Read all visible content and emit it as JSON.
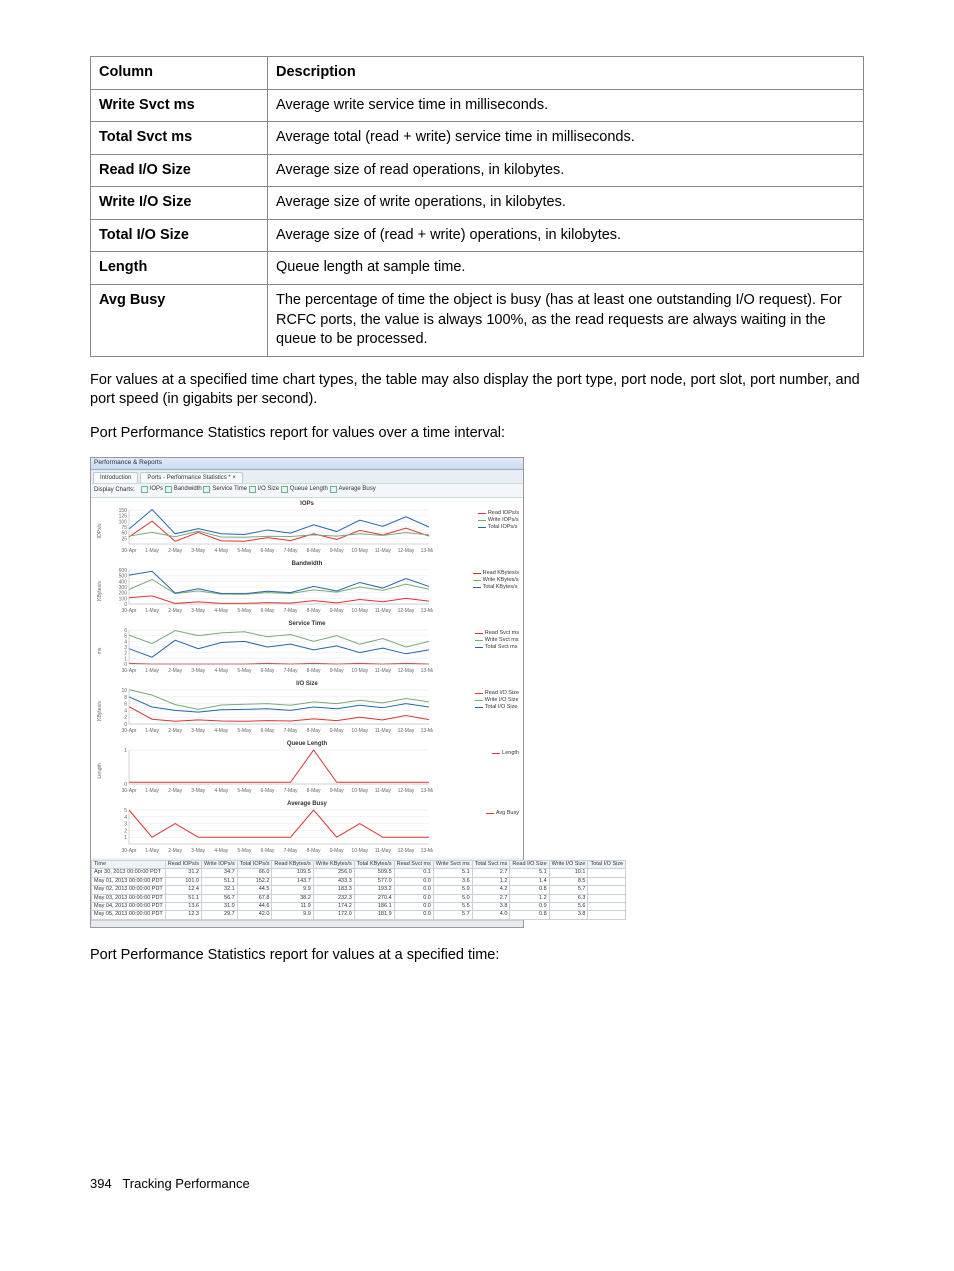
{
  "table": {
    "headers": [
      "Column",
      "Description"
    ],
    "rows": [
      {
        "col": "Write Svct ms",
        "desc": "Average write service time in milliseconds."
      },
      {
        "col": "Total Svct ms",
        "desc": "Average total (read + write) service time in milliseconds."
      },
      {
        "col": "Read I/O Size",
        "desc": "Average size of read operations, in kilobytes."
      },
      {
        "col": "Write I/O Size",
        "desc": "Average size of write operations, in kilobytes."
      },
      {
        "col": "Total I/O Size",
        "desc": "Average size of (read + write) operations, in kilobytes."
      },
      {
        "col": "Length",
        "desc": "Queue length at sample time."
      },
      {
        "col": "Avg Busy",
        "desc": "The percentage of time the object is busy (has at least one outstanding I/O request). For RCFC ports, the value is always 100%, as the read requests are always waiting in the queue to be processed."
      }
    ]
  },
  "para1": "For values at a specified time chart types, the table may also display the port type, port node, port slot, port number, and port speed (in gigabits per second).",
  "para2": "Port Performance Statistics report for values over a time interval:",
  "para3": "Port Performance Statistics report for values at a specified time:",
  "footer": {
    "page": "394",
    "title": "Tracking Performance"
  },
  "screenshot": {
    "windowTitle": "Performance & Reports",
    "tabs": [
      "Introduction",
      "Ports - Performance Statistics * ×"
    ],
    "toolbar": {
      "label": "Display Charts:",
      "checks": [
        "IOPs",
        "Bandwidth",
        "Service Time",
        "I/O Size",
        "Queue Length",
        "Average Busy"
      ]
    },
    "xcats": [
      "30-Apr",
      "1-May",
      "2-May",
      "3-May",
      "4-May",
      "5-May",
      "6-May",
      "7-May",
      "8-May",
      "9-May",
      "10-May",
      "11-May",
      "12-May",
      "13-May"
    ],
    "colors": {
      "read": "#d33",
      "write": "#7a7",
      "total": "#26a",
      "single": "#d33"
    },
    "dataHeaders": [
      "Time",
      "Read IOPs/s",
      "Write IOPs/s",
      "Total IOPs/s",
      "Read KBytes/s",
      "Write KBytes/s",
      "Total KBytes/s",
      "Read Svct ms",
      "Write Svct ms",
      "Total Svct ms",
      "Read I/O Size",
      "Write I/O Size",
      "Total I/O Size"
    ],
    "dataRows": [
      [
        "Apr 30, 2013 00:00:00 PDT",
        "31.2",
        "34.7",
        "66.0",
        "109.5",
        "256.0",
        "509.5",
        "0.1",
        "5.1",
        "2.7",
        "5.1",
        "10.1",
        ""
      ],
      [
        "May 01, 2013 00:00:00 PDT",
        "101.0",
        "51.1",
        "152.2",
        "143.7",
        "433.3",
        "577.0",
        "0.0",
        "3.6",
        "1.2",
        "1.4",
        "8.5",
        ""
      ],
      [
        "May 02, 2013 00:00:00 PDT",
        "12.4",
        "32.1",
        "44.5",
        "9.9",
        "183.3",
        "193.2",
        "0.0",
        "5.9",
        "4.2",
        "0.8",
        "5.7",
        ""
      ],
      [
        "May 03, 2013 00:00:00 PDT",
        "51.1",
        "56.7",
        "67.8",
        "38.2",
        "232.3",
        "270.4",
        "0.0",
        "5.0",
        "2.7",
        "1.2",
        "6.3",
        ""
      ],
      [
        "May 04, 2013 00:00:00 PDT",
        "13.6",
        "31.0",
        "44.6",
        "11.9",
        "174.2",
        "186.1",
        "0.0",
        "5.5",
        "3.8",
        "0.9",
        "5.6",
        ""
      ],
      [
        "May 05, 2013 00:00:00 PDT",
        "12.3",
        "29.7",
        "42.0",
        "9.9",
        "172.0",
        "181.9",
        "0.0",
        "5.7",
        "4.0",
        "0.8",
        "3.8",
        ""
      ]
    ]
  },
  "chart_data": [
    {
      "type": "line",
      "title": "IOPs",
      "ylabel": "IOPs/s",
      "x": [
        "30-Apr",
        "1-May",
        "2-May",
        "3-May",
        "4-May",
        "5-May",
        "6-May",
        "7-May",
        "8-May",
        "9-May",
        "10-May",
        "11-May",
        "12-May",
        "13-May"
      ],
      "ylim": [
        0,
        150
      ],
      "yticks": [
        25,
        50,
        75,
        100,
        125,
        150
      ],
      "series": [
        {
          "name": "Read IOPs/s",
          "color": "#d33",
          "values": [
            31,
            101,
            12,
            51,
            14,
            12,
            28,
            15,
            45,
            20,
            60,
            40,
            70,
            35
          ]
        },
        {
          "name": "Write IOPs/s",
          "color": "#7a7",
          "values": [
            35,
            51,
            32,
            57,
            31,
            30,
            34,
            33,
            40,
            35,
            45,
            38,
            50,
            40
          ]
        },
        {
          "name": "Total IOPs/s",
          "color": "#26a",
          "values": [
            66,
            152,
            45,
            68,
            45,
            42,
            62,
            48,
            85,
            55,
            105,
            78,
            120,
            75
          ]
        }
      ]
    },
    {
      "type": "line",
      "title": "Bandwidth",
      "ylabel": "KBytes/s",
      "x": [
        "30-Apr",
        "1-May",
        "2-May",
        "3-May",
        "4-May",
        "5-May",
        "6-May",
        "7-May",
        "8-May",
        "9-May",
        "10-May",
        "11-May",
        "12-May",
        "13-May"
      ],
      "ylim": [
        0,
        600
      ],
      "yticks": [
        0,
        100,
        200,
        300,
        400,
        500,
        600
      ],
      "series": [
        {
          "name": "Read KBytes/s",
          "color": "#d33",
          "values": [
            110,
            144,
            10,
            38,
            12,
            10,
            25,
            15,
            60,
            20,
            80,
            40,
            100,
            50
          ]
        },
        {
          "name": "Write KBytes/s",
          "color": "#7a7",
          "values": [
            256,
            433,
            183,
            232,
            174,
            172,
            200,
            185,
            250,
            210,
            300,
            240,
            350,
            260
          ]
        },
        {
          "name": "Total KBytes/s",
          "color": "#26a",
          "values": [
            510,
            577,
            193,
            270,
            186,
            182,
            225,
            200,
            310,
            230,
            380,
            280,
            450,
            310
          ]
        }
      ]
    },
    {
      "type": "line",
      "title": "Service Time",
      "ylabel": "ms",
      "x": [
        "30-Apr",
        "1-May",
        "2-May",
        "3-May",
        "4-May",
        "5-May",
        "6-May",
        "7-May",
        "8-May",
        "9-May",
        "10-May",
        "11-May",
        "12-May",
        "13-May"
      ],
      "ylim": [
        0,
        6
      ],
      "yticks": [
        0,
        1,
        2,
        3,
        4,
        5,
        6
      ],
      "series": [
        {
          "name": "Read Svct ms",
          "color": "#d33",
          "values": [
            0.1,
            0.0,
            0.0,
            0.0,
            0.0,
            0.0,
            0.1,
            0.0,
            0.1,
            0.0,
            0.1,
            0.0,
            0.1,
            0.0
          ]
        },
        {
          "name": "Write Svct ms",
          "color": "#7a7",
          "values": [
            5.1,
            3.6,
            5.9,
            5.0,
            5.5,
            5.7,
            4.8,
            5.2,
            4.0,
            5.0,
            3.5,
            4.5,
            3.0,
            4.0
          ]
        },
        {
          "name": "Total Svct ms",
          "color": "#26a",
          "values": [
            2.7,
            1.2,
            4.2,
            2.7,
            3.8,
            4.0,
            3.0,
            3.5,
            2.5,
            3.2,
            2.0,
            2.8,
            1.8,
            2.5
          ]
        }
      ]
    },
    {
      "type": "line",
      "title": "I/O Size",
      "ylabel": "KBytes/s",
      "x": [
        "30-Apr",
        "1-May",
        "2-May",
        "3-May",
        "4-May",
        "5-May",
        "6-May",
        "7-May",
        "8-May",
        "9-May",
        "10-May",
        "11-May",
        "12-May",
        "13-May"
      ],
      "ylim": [
        0,
        10
      ],
      "yticks": [
        0,
        2,
        4,
        6,
        8,
        10
      ],
      "series": [
        {
          "name": "Read I/O Size",
          "color": "#d33",
          "values": [
            5.1,
            1.4,
            0.8,
            1.2,
            0.9,
            0.8,
            1.0,
            0.9,
            1.5,
            1.0,
            2.0,
            1.2,
            2.5,
            1.3
          ]
        },
        {
          "name": "Write I/O Size",
          "color": "#7a7",
          "values": [
            10.1,
            8.5,
            5.7,
            4.3,
            5.6,
            5.8,
            6.0,
            5.5,
            6.5,
            6.0,
            7.0,
            6.2,
            7.5,
            6.5
          ]
        },
        {
          "name": "Total I/O Size",
          "color": "#26a",
          "values": [
            8.0,
            5.0,
            4.0,
            3.5,
            4.2,
            4.3,
            4.5,
            4.0,
            5.0,
            4.5,
            5.5,
            4.8,
            6.0,
            5.0
          ]
        }
      ]
    },
    {
      "type": "line",
      "title": "Queue Length",
      "ylabel": "Length",
      "x": [
        "30-Apr",
        "1-May",
        "2-May",
        "3-May",
        "4-May",
        "5-May",
        "6-May",
        "7-May",
        "8-May",
        "9-May",
        "10-May",
        "11-May",
        "12-May",
        "13-May"
      ],
      "ylim": [
        0,
        1
      ],
      "yticks": [
        0,
        1
      ],
      "series": [
        {
          "name": "Length",
          "color": "#d33",
          "values": [
            0.05,
            0.05,
            0.05,
            0.05,
            0.05,
            0.05,
            0.05,
            0.05,
            1.0,
            0.05,
            0.05,
            0.05,
            0.05,
            0.05
          ]
        }
      ]
    },
    {
      "type": "line",
      "title": "Average Busy",
      "ylabel": "",
      "x": [
        "30-Apr",
        "1-May",
        "2-May",
        "3-May",
        "4-May",
        "5-May",
        "6-May",
        "7-May",
        "8-May",
        "9-May",
        "10-May",
        "11-May",
        "12-May",
        "13-May"
      ],
      "ylim": [
        0,
        5
      ],
      "yticks": [
        1,
        2,
        3,
        4,
        5
      ],
      "series": [
        {
          "name": "Avg Busy",
          "color": "#d33",
          "values": [
            5,
            1,
            3,
            1,
            1,
            1,
            1,
            1,
            5,
            1,
            3,
            1,
            1,
            1
          ]
        }
      ]
    }
  ]
}
